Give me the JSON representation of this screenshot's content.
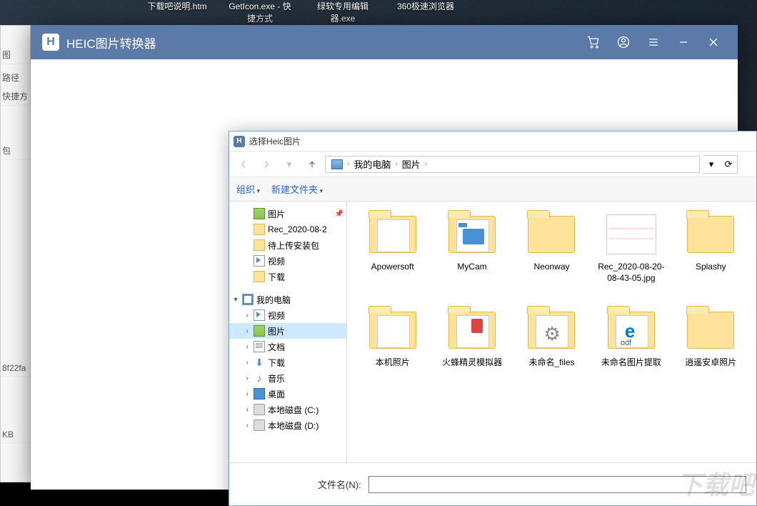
{
  "desktop_icons": [
    "下载吧说明.htm",
    "GetIcon.exe - 快捷方式",
    "绿软专用编辑器.exe",
    "360极速浏览器"
  ],
  "bg_app": {
    "labels": [
      "图",
      "路径",
      "快捷方",
      "包",
      "8f22fa",
      "KB"
    ]
  },
  "main": {
    "title": "HEIC图片转换器",
    "logo_letter": "H"
  },
  "picker": {
    "logo_letter": "H",
    "title": "选择Heic图片",
    "breadcrumb": [
      "我的电脑",
      "图片"
    ],
    "toolbar": {
      "organize": "组织",
      "new_folder": "新建文件夹"
    },
    "tree": {
      "quick": [
        {
          "label": "图片",
          "icon": "pic",
          "pinned": true
        },
        {
          "label": "Rec_2020-08-2",
          "icon": "fld"
        },
        {
          "label": "待上传安装包",
          "icon": "fld"
        },
        {
          "label": "视频",
          "icon": "vid"
        },
        {
          "label": "下载",
          "icon": "fld"
        }
      ],
      "pc_label": "我的电脑",
      "pc_children": [
        {
          "label": "视频",
          "icon": "vid"
        },
        {
          "label": "图片",
          "icon": "pic",
          "selected": true
        },
        {
          "label": "文档",
          "icon": "doc"
        },
        {
          "label": "下载",
          "icon": "dl"
        },
        {
          "label": "音乐",
          "icon": "mus"
        },
        {
          "label": "桌面",
          "icon": "dsk"
        },
        {
          "label": "本地磁盘 (C:)",
          "icon": "drv"
        },
        {
          "label": "本地磁盘 (D:)",
          "icon": "drv"
        }
      ]
    },
    "items": [
      {
        "label": "Apowersoft",
        "type": "folder-paper"
      },
      {
        "label": "MyCam",
        "type": "folder-cam"
      },
      {
        "label": "Neonway",
        "type": "folder"
      },
      {
        "label": "Rec_2020-08-20-08-43-05.jpg",
        "type": "jpg"
      },
      {
        "label": "Splashy",
        "type": "folder"
      },
      {
        "label": "本机照片",
        "type": "folder-paper"
      },
      {
        "label": "火蜂精灵模拟器",
        "type": "folder-mix"
      },
      {
        "label": "未命名_files",
        "type": "folder-gear"
      },
      {
        "label": "未命名图片提取",
        "type": "folder-edge"
      },
      {
        "label": "逍遥安卓照片",
        "type": "folder"
      }
    ],
    "footer": {
      "filename_label": "文件名(N):",
      "filename_value": ""
    }
  },
  "watermark": "下载吧"
}
